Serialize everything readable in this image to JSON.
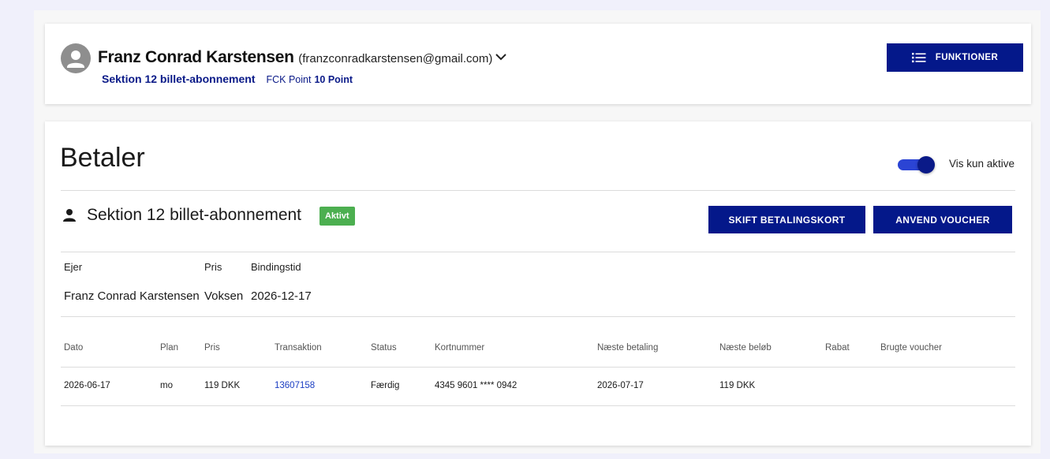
{
  "user": {
    "name": "Franz Conrad Karstensen",
    "email": "(franzconradkarstensen@gmail.com)",
    "subscription": "Sektion 12 billet-abonnement",
    "points_label": "FCK Point",
    "points_value": "10 Point"
  },
  "actions": {
    "functions_label": "FUNKTIONER"
  },
  "payer": {
    "title": "Betaler",
    "toggle_label": "Vis kun aktive",
    "toggle_on": true
  },
  "subscription": {
    "title": "Sektion 12 billet-abonnement",
    "status_badge": "Aktivt",
    "change_card_label": "SKIFT BETALINGSKORT",
    "apply_voucher_label": "ANVEND VOUCHER",
    "info_headers": [
      "Ejer",
      "Pris",
      "Bindingstid"
    ],
    "info_values": [
      "Franz Conrad Karstensen",
      "Voksen",
      "2026-12-17"
    ]
  },
  "payments": {
    "headers": [
      "Dato",
      "Plan",
      "Pris",
      "Transaktion",
      "Status",
      "Kortnummer",
      "Næste betaling",
      "Næste beløb",
      "Rabat",
      "Brugte voucher"
    ],
    "rows": [
      [
        "2026-06-17",
        "mo",
        "119 DKK",
        "13607158",
        "Færdig",
        "4345 9601 **** 0942",
        "2026-07-17",
        "119 DKK",
        "",
        ""
      ]
    ]
  },
  "colors": {
    "brand_navy": "#04188a",
    "badge_green": "#4caf50",
    "link_blue": "#1a3dc2"
  }
}
